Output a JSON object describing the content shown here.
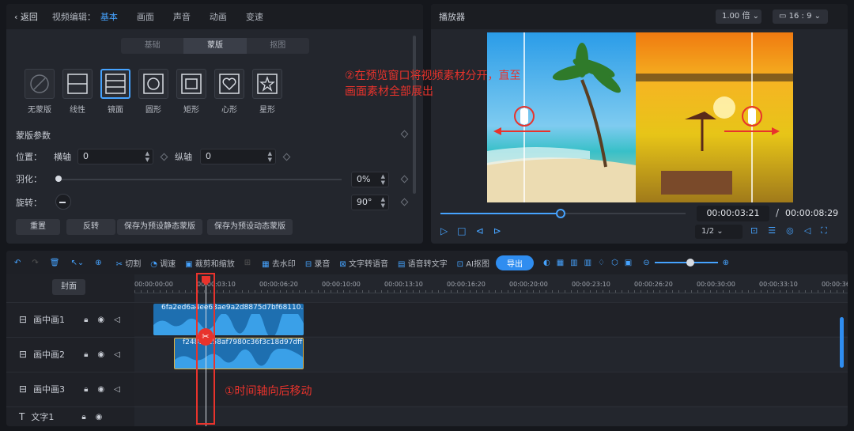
{
  "editor": {
    "back": "返回",
    "section": "视频编辑：",
    "tabs": [
      "基本",
      "画面",
      "声音",
      "动画",
      "变速"
    ],
    "subtabs": [
      "基础",
      "蒙版",
      "抠图"
    ],
    "shapes": [
      "无蒙版",
      "线性",
      "镜面",
      "圆形",
      "矩形",
      "心形",
      "星形"
    ],
    "params_title": "蒙版参数",
    "position_label": "位置：",
    "h_label": "横轴",
    "h_value": "0",
    "v_label": "纵轴",
    "v_value": "0",
    "feather_label": "羽化：",
    "feather_value": "0%",
    "rotate_label": "旋转：",
    "rotate_value": "90°",
    "buttons": [
      "重置",
      "反转",
      "保存为预设静态蒙版",
      "保存为预设动态蒙版"
    ]
  },
  "player": {
    "title": "播放器",
    "speed": "1.00 倍",
    "ratio": "16 : 9",
    "current_time": "00:00:03:21",
    "separator": "/",
    "total_time": "00:00:08:29",
    "quality": "1/2",
    "progress": 0.49
  },
  "annotation_top": "②在预览窗口将视频素材分开，直至画面素材全部展出",
  "annotation_bottom": "①时间轴向后移动",
  "toolbar": {
    "items": [
      "切割",
      "调速",
      "裁剪和缩放",
      "去水印",
      "录音",
      "文字转语音",
      "语音转文字",
      "AI抠图"
    ],
    "export": "导出"
  },
  "timeline": {
    "cover": "封面",
    "ruler": [
      "00:00:00:00",
      "00:00:03:10",
      "00:00:06:20",
      "00:00:10:00",
      "00:00:13:10",
      "00:00:16:20",
      "00:00:20:00",
      "00:00:23:10",
      "00:00:26:20",
      "00:00:30:00",
      "00:00:33:10",
      "00:00:36"
    ],
    "tracks": [
      "画中画1",
      "画中画2",
      "画中画3",
      "文字1"
    ],
    "clip1": "6fa2ed6a4ee63ae9a2d8875d7bf68110.",
    "clip2": "f24817258af7980c36f3c18d97dff"
  }
}
